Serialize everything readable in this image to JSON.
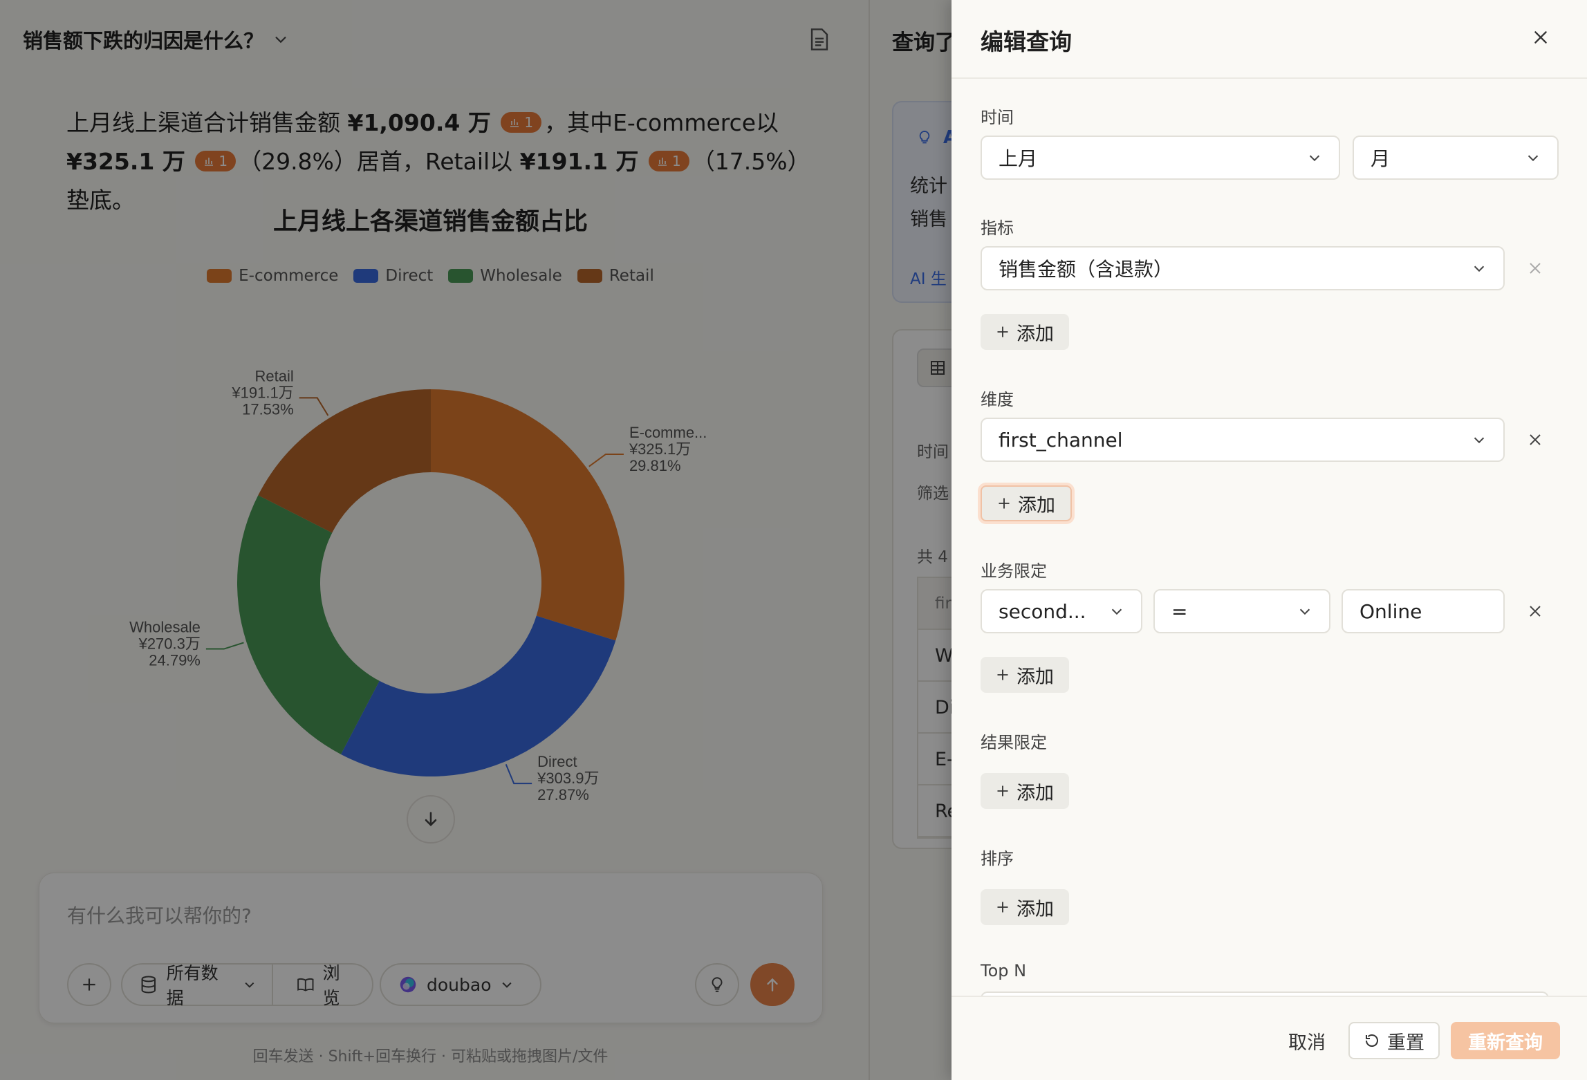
{
  "conversation": {
    "title": "销售额下跌的归因是什么？",
    "summary": {
      "p1": "上月线上渠道合计销售金额 ",
      "v1": "¥1,090.4 万",
      "p2": "，其中E-commerce以",
      "v2": "¥325.1 万",
      "p3": "（29.8%）居首，Retail以 ",
      "v3": "¥191.1 万",
      "p4": "（17.5%）垫底。",
      "ref_count": "1"
    }
  },
  "chart_data": {
    "type": "pie",
    "title": "上月线上各渠道销售金额占比",
    "legend_position": "top",
    "categories": [
      "E-commerce",
      "Direct",
      "Wholesale",
      "Retail"
    ],
    "values": [
      325.1,
      303.9,
      270.3,
      191.1
    ],
    "percents": [
      29.81,
      27.87,
      24.79,
      17.53
    ],
    "label_names": [
      "E-comme...",
      "Direct",
      "Wholesale",
      "Retail"
    ],
    "label_values": [
      "¥325.1万",
      "¥303.9万",
      "¥270.3万",
      "¥191.1万"
    ],
    "label_percents": [
      "29.81%",
      "27.87%",
      "24.79%",
      "17.53%"
    ],
    "colors": [
      "#e07a2e",
      "#3a6be0",
      "#4a9a56",
      "#b8662a"
    ],
    "donut": true
  },
  "composer": {
    "placeholder": "有什么我可以帮你的?",
    "data_label": "所有数据",
    "browse_label": "浏览",
    "model_label": "doubao",
    "hint": "回车发送 · Shift+回车换行 · 可粘贴或拖拽图片/文件"
  },
  "result_panel": {
    "title": "查询了",
    "card_title": "A",
    "card_text_1": "统计",
    "card_text_2": "销售",
    "card_footer": "AI 生",
    "label_time": "时间",
    "label_filter": "筛选",
    "count_text": "共 4",
    "table_header": "fir",
    "rows": [
      "W",
      "Di",
      "E-",
      "Re"
    ]
  },
  "drawer": {
    "title": "编辑查询",
    "time_label": "时间",
    "time_value": "上月",
    "grain_value": "月",
    "metric_label": "指标",
    "metric_value": "销售金额（含退款）",
    "dimension_label": "维度",
    "dimension_value": "first_channel",
    "biz_label": "业务限定",
    "filter_field": "second...",
    "filter_op": "=",
    "filter_value": "Online",
    "result_label": "结果限定",
    "sort_label": "排序",
    "topn_label": "Top N",
    "add_label": "添加",
    "cancel_label": "取消",
    "reset_label": "重置",
    "requery_label": "重新查询"
  }
}
